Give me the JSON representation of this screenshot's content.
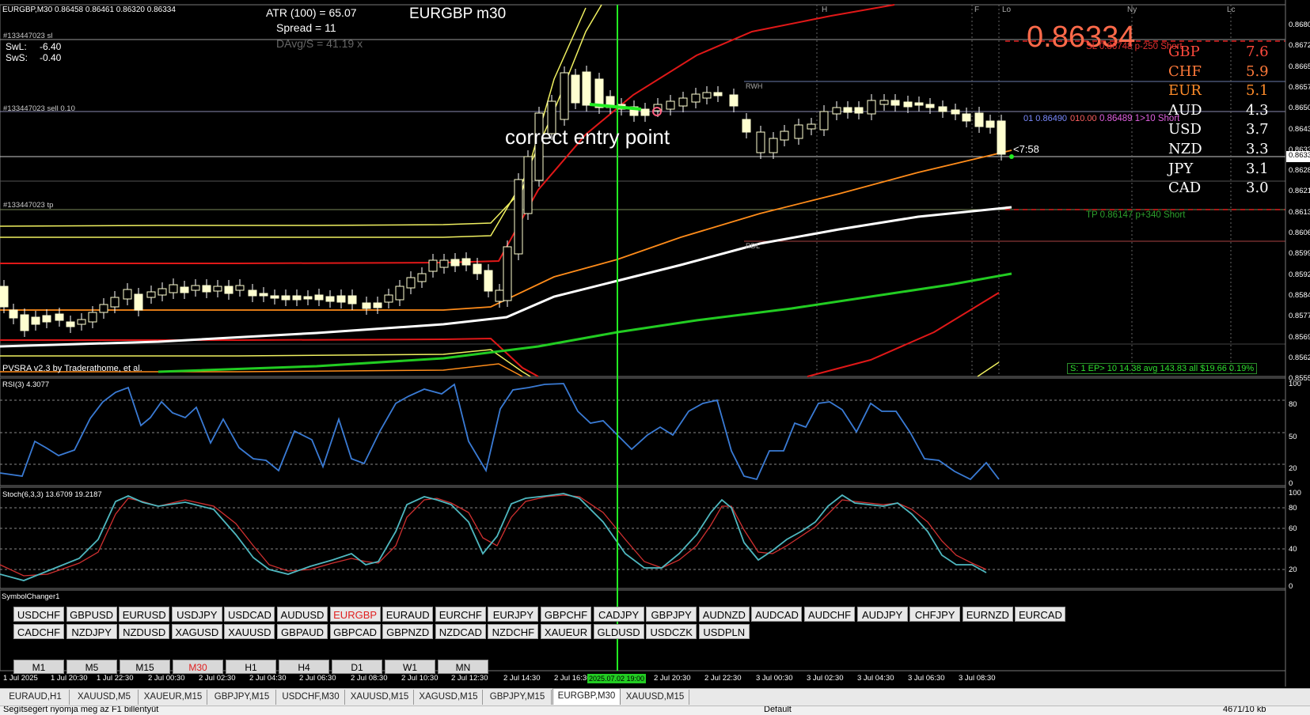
{
  "chart": {
    "header_line": "EURGBP,M30  0.86458 0.86461 0.86320 0.86334",
    "title": "EURGBP m30",
    "atr_text": "ATR (100) =  65.07",
    "spread_text": "Spread  =  11",
    "davg_text": "DAvg/S  =  41.19 x",
    "swl_label": "SwL:",
    "swl_value": "-6.40",
    "sws_label": "SwS:",
    "sws_value": "-0.40",
    "order_sl": "#133447023 sl",
    "order_sell": "#133447023 sell 0.10",
    "order_tp": "#133447023 tp",
    "annotation": "correct entry point",
    "current_price": "0.86334",
    "sl_text": "SL 0.86748 p-250 Short",
    "entry_text_a": "01  0.86490",
    "entry_text_b": "010.00",
    "entry_text_c": "0.86489  1>10 Short",
    "tp_text": "TP  0.86147 p+340 Short",
    "countdown": "<7:58",
    "rwh": "RWH",
    "rdl": "RDL",
    "pvsra": "PVSRA  v2.3  by  Traderathome,  et al.",
    "stats": "S: 1 EP> 10  14.38 avg  143.83 all  $19.66  0.19%",
    "session_labels": [
      "H",
      "F",
      "Lo",
      "Ny",
      "Lc"
    ]
  },
  "strength": [
    {
      "ccy": "GBP",
      "value": "7.6",
      "color": "#ff4a3d"
    },
    {
      "ccy": "CHF",
      "value": "5.9",
      "color": "#ff7a3a"
    },
    {
      "ccy": "EUR",
      "value": "5.1",
      "color": "#ff8c2a"
    },
    {
      "ccy": "AUD",
      "value": "4.3",
      "color": "#ffffff"
    },
    {
      "ccy": "USD",
      "value": "3.7",
      "color": "#ffffff"
    },
    {
      "ccy": "NZD",
      "value": "3.3",
      "color": "#ffffff"
    },
    {
      "ccy": "JPY",
      "value": "3.1",
      "color": "#ffffff"
    },
    {
      "ccy": "CAD",
      "value": "3.0",
      "color": "#ffffff"
    }
  ],
  "price_axis": {
    "main": [
      "0.8680",
      "0.8672",
      "0.8665",
      "0.8657",
      "0.8650",
      "0.8643",
      "0.8633",
      "0.8628",
      "0.8621",
      "0.8613",
      "0.8606",
      "0.8599",
      "0.8592",
      "0.8584",
      "0.8577",
      "0.8569",
      "0.8562",
      "0.8555"
    ],
    "rsi": [
      "100",
      "80",
      "50",
      "20",
      "0"
    ],
    "stoch": [
      "100",
      "80",
      "60",
      "40",
      "20",
      "0"
    ],
    "current_tag": "0.8633"
  },
  "rsi": {
    "label": "RSI(3) 4.3077"
  },
  "stoch": {
    "label": "Stoch(6,3,3) 13.6709 19.2187"
  },
  "symbol_changer": {
    "label": "SymbolChanger1",
    "row1": [
      "USDCHF",
      "GBPUSD",
      "EURUSD",
      "USDJPY",
      "USDCAD",
      "AUDUSD",
      "EURGBP",
      "EURAUD",
      "EURCHF",
      "EURJPY",
      "GBPCHF",
      "CADJPY",
      "GBPJPY",
      "AUDNZD",
      "AUDCAD",
      "AUDCHF",
      "AUDJPY",
      "CHFJPY",
      "EURNZD",
      "EURCAD"
    ],
    "row2": [
      "CADCHF",
      "NZDJPY",
      "NZDUSD",
      "XAGUSD",
      "XAUUSD",
      "GBPAUD",
      "GBPCAD",
      "GBPNZD",
      "NZDCAD",
      "NZDCHF",
      "XAUEUR",
      "GLDUSD",
      "USDCZK",
      "USDPLN"
    ],
    "active": "EURGBP",
    "active_color": "#e02020"
  },
  "timeframes": {
    "items": [
      "M1",
      "M5",
      "M15",
      "M30",
      "H1",
      "H4",
      "D1",
      "W1",
      "MN"
    ],
    "active": "M30"
  },
  "time_axis": [
    "1 Jul 2025",
    "1 Jul 20:30",
    "1 Jul 22:30",
    "2 Jul 00:30",
    "2 Jul 02:30",
    "2 Jul 04:30",
    "2 Jul 06:30",
    "2 Jul 08:30",
    "2 Jul 10:30",
    "2 Jul 12:30",
    "2 Jul 14:30",
    "2 Jul 16:30",
    "2 Jul 20:30",
    "2 Jul 22:30",
    "3 Jul 00:30",
    "3 Jul 02:30",
    "3 Jul 04:30",
    "3 Jul 06:30",
    "3 Jul 08:30"
  ],
  "crosshair_time": "2025.07.02 19:00",
  "tabs": [
    "EURAUD,H1",
    "XAUUSD,M5",
    "XAUEUR,M15",
    "GBPJPY,M15",
    "USDCHF,M30",
    "XAUUSD,M15",
    "XAGUSD,M15",
    "GBPJPY,M15",
    "EURGBP,M30",
    "XAUUSD,M15"
  ],
  "active_tab": "EURGBP,M30",
  "status": {
    "left": "Segítségért nyomja meg az F1 billentyűt",
    "mid": "Default",
    "right": "4671/10 kb"
  },
  "colors": {
    "bull": "#ffffd0",
    "bear": "#ffffff",
    "rsi": "#3a7bd5",
    "stoch_main": "#4fb8c0",
    "stoch_signal": "#d03030",
    "ma_white": "#ffffff",
    "ma_green": "#22cc22",
    "ma_orange": "#ff8c1a",
    "band_red": "#e01818",
    "band_yellow": "#f0f060",
    "crosshair": "#22ee22"
  }
}
